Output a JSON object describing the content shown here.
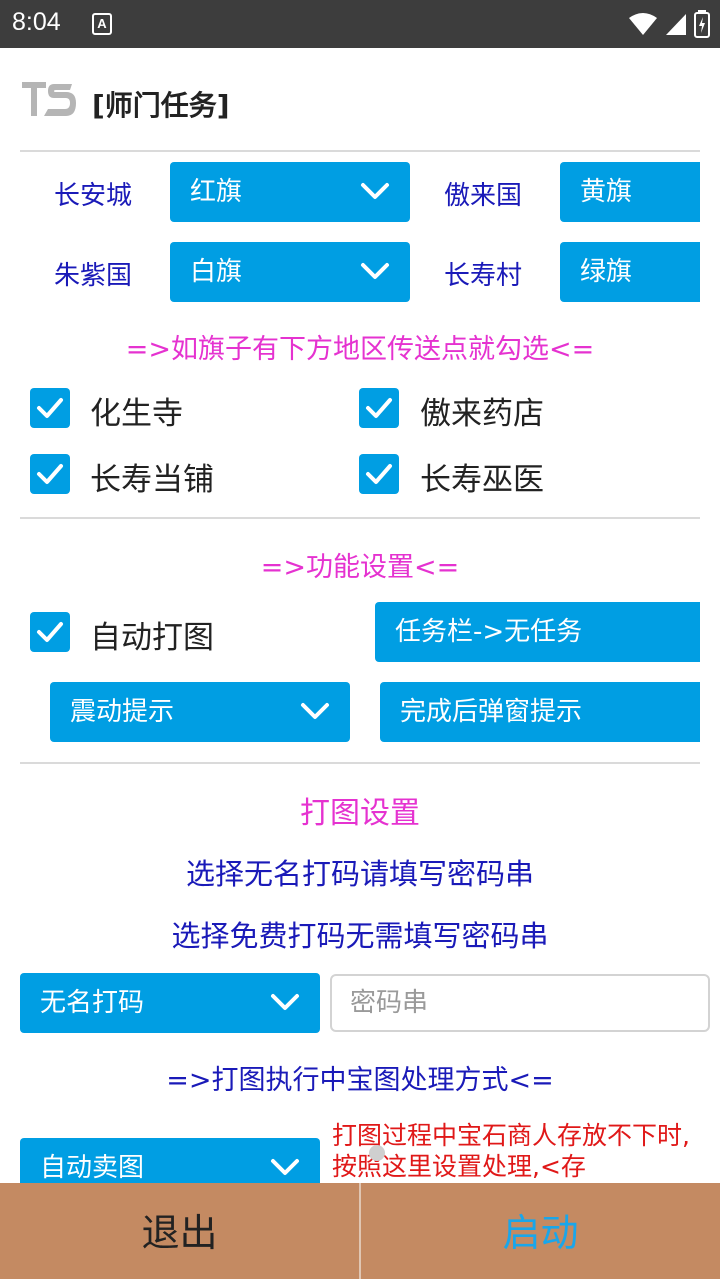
{
  "status_bar": {
    "time": "8:04",
    "notif_letter": "A"
  },
  "header": {
    "title": "[师门任务]",
    "logo_text": "TS"
  },
  "flags": [
    {
      "region": "长安城",
      "flag": "红旗"
    },
    {
      "region": "傲来国",
      "flag": "黄旗"
    },
    {
      "region": "朱紫国",
      "flag": "白旗"
    },
    {
      "region": "长寿村",
      "flag": "绿旗"
    }
  ],
  "teleport_hint": "=>如旗子有下方地区传送点就勾选<=",
  "teleport_points": [
    {
      "label": "化生寺",
      "checked": true
    },
    {
      "label": "傲来药店",
      "checked": true
    },
    {
      "label": "长寿当铺",
      "checked": true
    },
    {
      "label": "长寿巫医",
      "checked": true
    }
  ],
  "function_header": "=>功能设置<=",
  "auto_map": {
    "label": "自动打图",
    "checked": true
  },
  "task_bar_button": "任务栏->无任务",
  "vibrate_select": "震动提示",
  "popup_button": "完成后弹窗提示",
  "map_settings_title": "打图设置",
  "hint1": "选择无名打码请填写密码串",
  "hint2": "选择免费打码无需填写密码串",
  "captcha_select": "无名打码",
  "password_placeholder": "密码串",
  "treasure_header": "=>打图执行中宝图处理方式<=",
  "treasure_select": "自动卖图",
  "treasure_note": "打图过程中宝石商人存放不下时,按照这里设置处理,<存",
  "bottom": {
    "exit": "退出",
    "start": "启动"
  },
  "colors": {
    "accent": "#009ee3",
    "pink": "#e532d0",
    "navy": "#1a1ab8",
    "bottom_bar": "#c48a62",
    "red": "#e01818"
  }
}
